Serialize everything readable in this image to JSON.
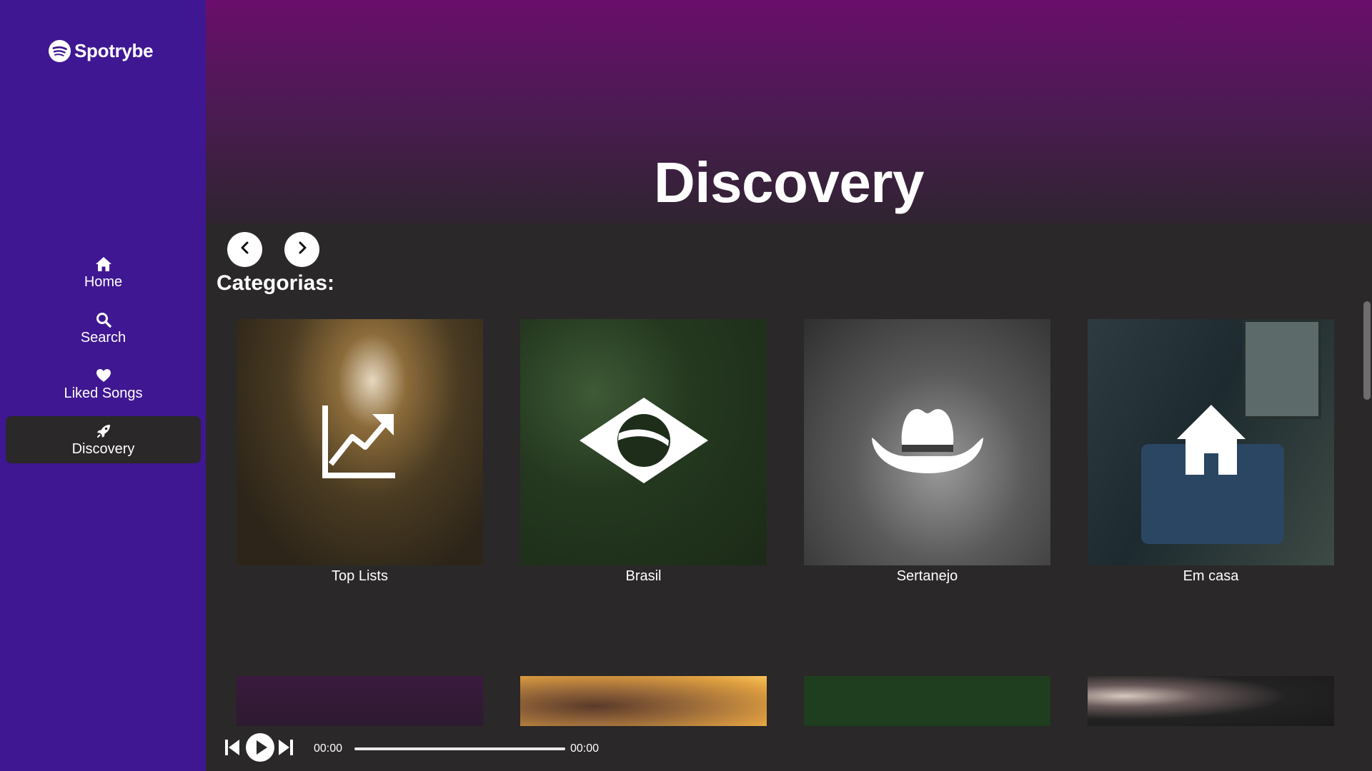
{
  "app": {
    "name": "Spotrybe"
  },
  "sidebar": {
    "items": [
      {
        "label": "Home",
        "icon": "home-icon",
        "active": false
      },
      {
        "label": "Search",
        "icon": "search-icon",
        "active": false
      },
      {
        "label": "Liked Songs",
        "icon": "heart-icon",
        "active": false
      },
      {
        "label": "Discovery",
        "icon": "rocket-icon",
        "active": true
      }
    ]
  },
  "main": {
    "title": "Discovery",
    "section_title": "Categorias:",
    "categories": [
      {
        "label": "Top Lists",
        "icon": "trending-up-icon"
      },
      {
        "label": "Brasil",
        "icon": "brazil-flag-icon"
      },
      {
        "label": "Sertanejo",
        "icon": "cowboy-hat-icon"
      },
      {
        "label": "Em casa",
        "icon": "house-icon"
      }
    ]
  },
  "player": {
    "current_time": "00:00",
    "duration": "00:00",
    "progress": 0
  },
  "colors": {
    "sidebar_bg": "#3f1792",
    "main_bg": "#2a2828",
    "hero_top": "#6a0e6b",
    "text": "#ffffff"
  }
}
